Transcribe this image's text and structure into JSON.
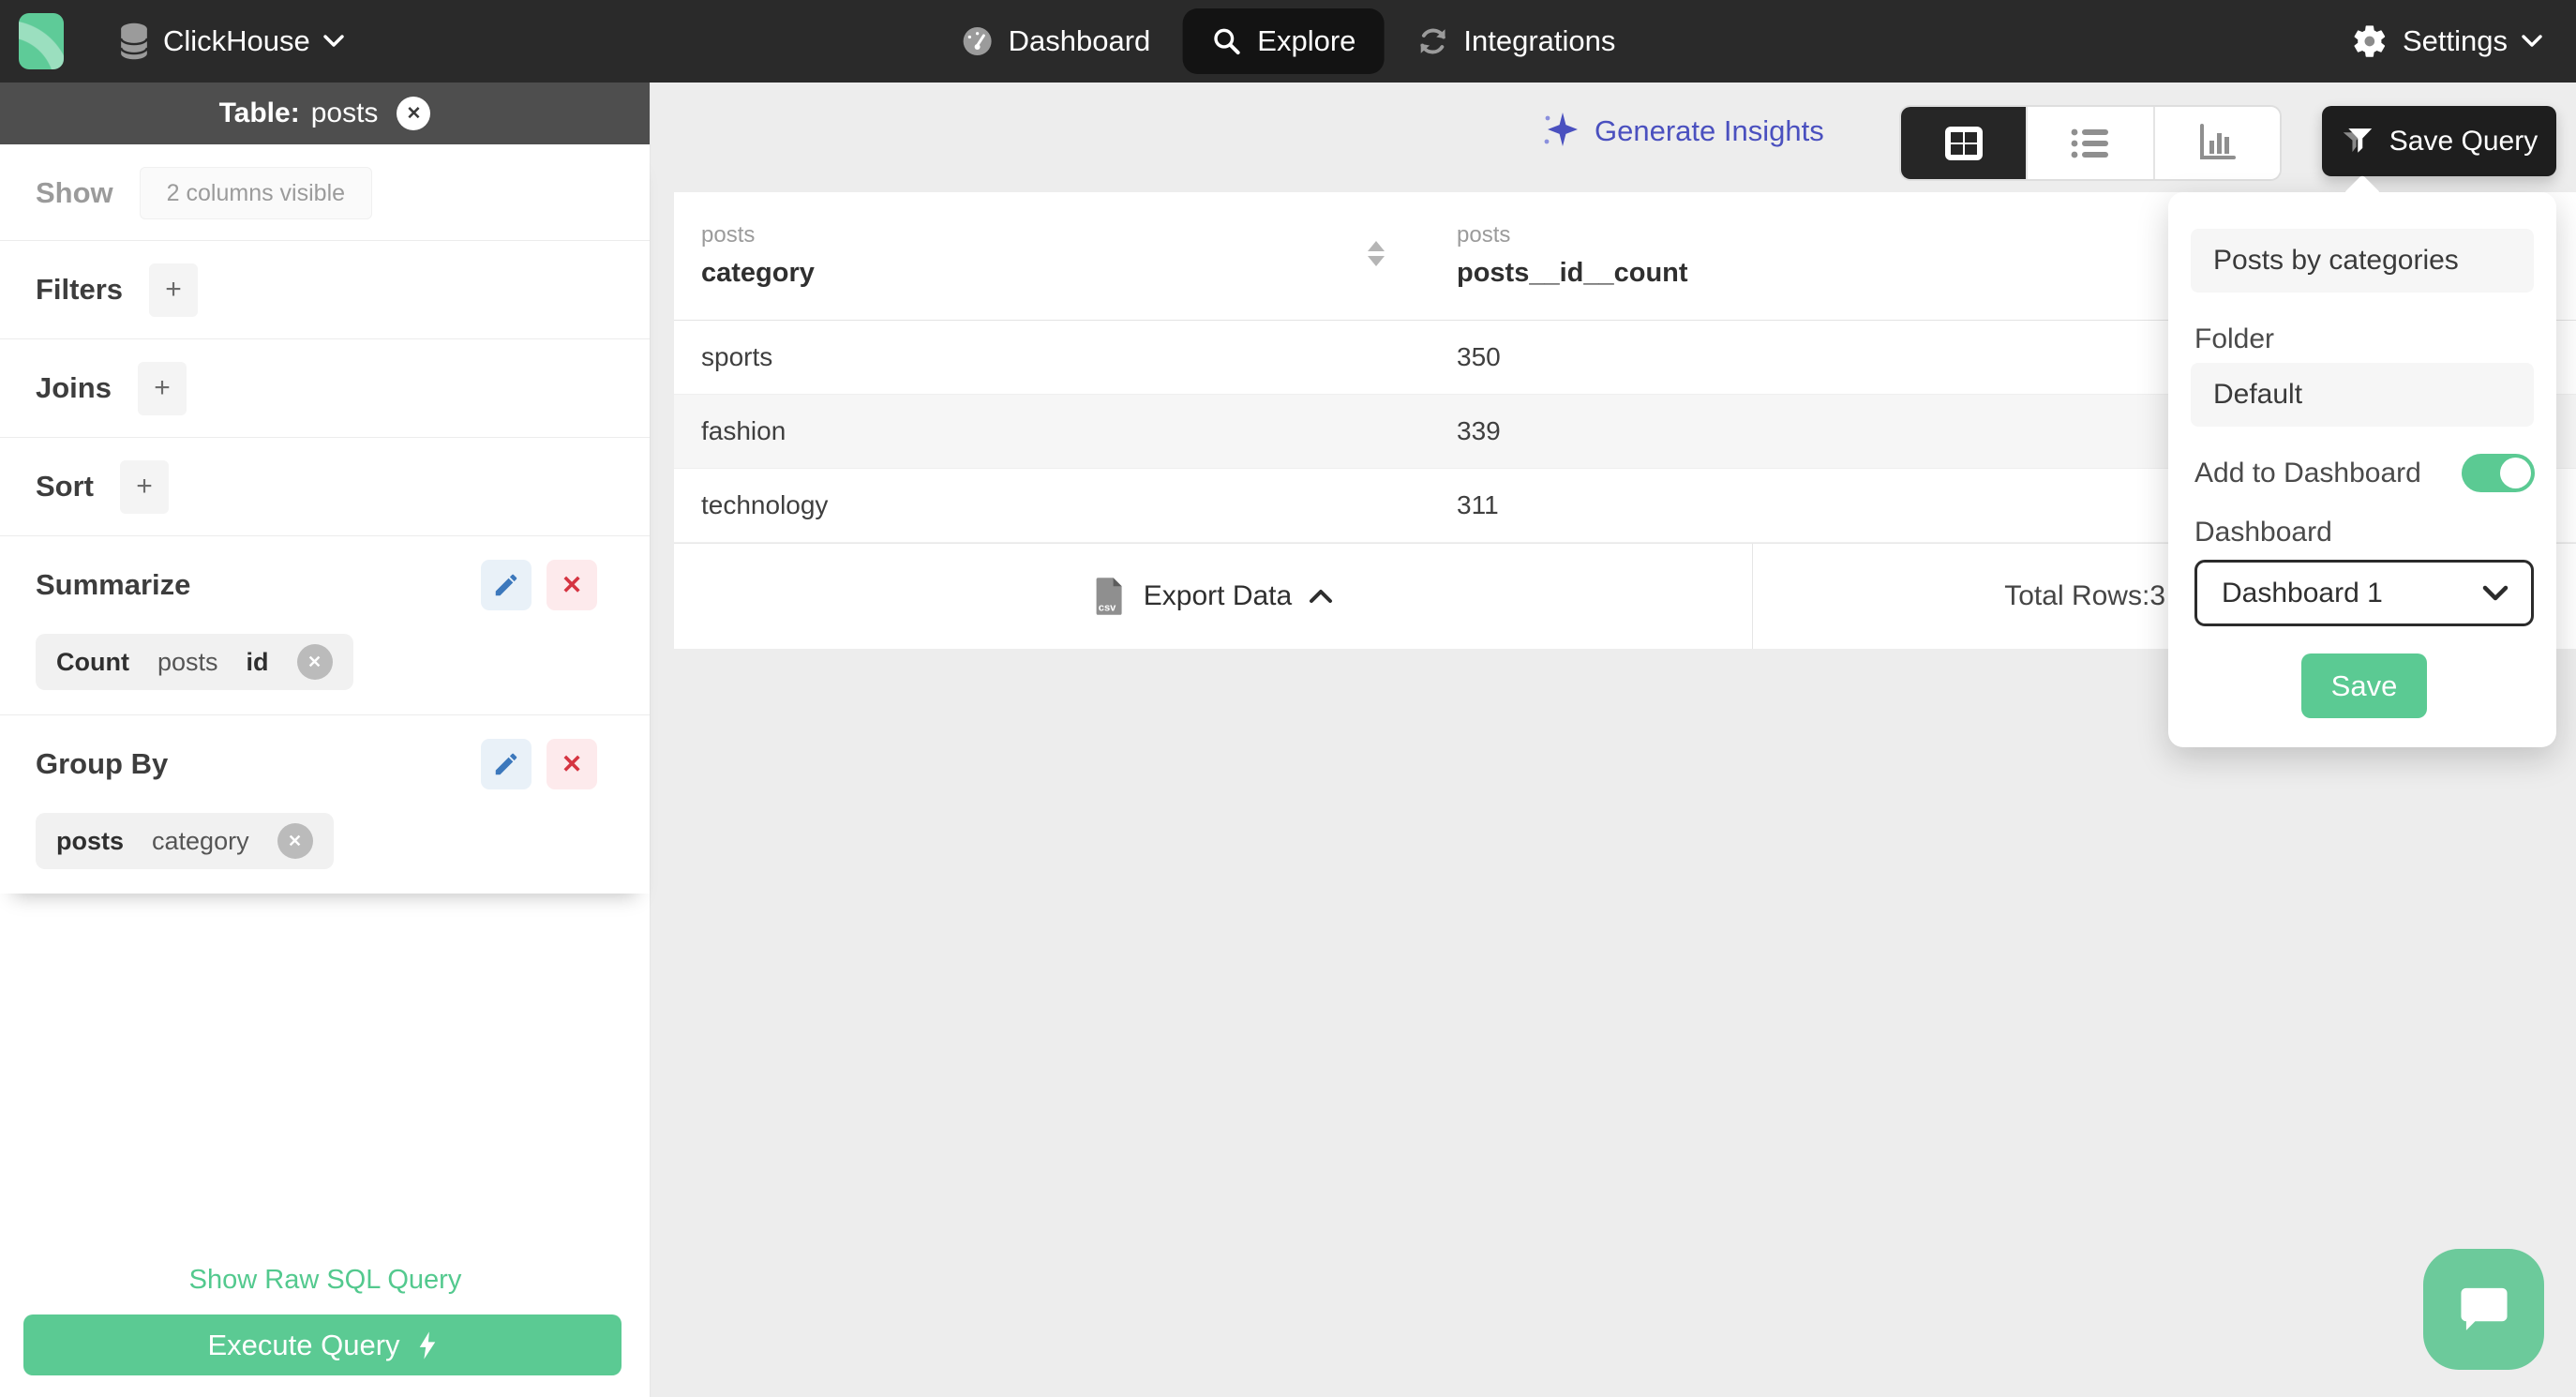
{
  "topbar": {
    "brand": {
      "name": "ClickHouse"
    },
    "nav": [
      {
        "label": "Dashboard"
      },
      {
        "label": "Explore"
      },
      {
        "label": "Integrations"
      }
    ],
    "settings": {
      "label": "Settings"
    }
  },
  "sidebar": {
    "table_chip": {
      "label": "Table:",
      "value": "posts"
    },
    "show_label": "Show",
    "columns_badge": "2 columns visible",
    "filters_label": "Filters",
    "joins_label": "Joins",
    "sort_label": "Sort",
    "summarize": {
      "label": "Summarize",
      "chip": {
        "agg": "Count",
        "table": "posts",
        "column": "id"
      }
    },
    "group_by": {
      "label": "Group By",
      "chip": {
        "table": "posts",
        "column": "category"
      }
    },
    "raw_sql_link": "Show Raw SQL Query",
    "execute_button": "Execute Query"
  },
  "toolbar": {
    "generate_insights": "Generate Insights",
    "save_query": "Save Query"
  },
  "results": {
    "columns": [
      {
        "table": "posts",
        "name": "category"
      },
      {
        "table": "posts",
        "name": "posts__id__count"
      }
    ],
    "rows": [
      {
        "category": "sports",
        "count": "350"
      },
      {
        "category": "fashion",
        "count": "339"
      },
      {
        "category": "technology",
        "count": "311"
      }
    ],
    "export_label": "Export Data",
    "export_icon_label": "csv",
    "total_rows_label": "Total Rows:",
    "total_rows_value": "3"
  },
  "save_popover": {
    "query_name": "Posts by categories",
    "folder_label": "Folder",
    "folder_value": "Default",
    "add_to_dashboard_label": "Add to Dashboard",
    "add_to_dashboard_on": true,
    "dashboard_label": "Dashboard",
    "dashboard_value": "Dashboard 1",
    "save_label": "Save"
  },
  "glyphs": {
    "plus": "+",
    "close": "✕"
  },
  "colors": {
    "topbar": "#2a2a2a",
    "active_pill": "#131313",
    "accent_green": "#5bca93",
    "link_green": "#53c98e",
    "insights_indigo": "#4a50bf",
    "pencil_blue": "#3c78bc",
    "danger_red": "#d53441",
    "table_bar_gray": "#4e4e4e"
  }
}
